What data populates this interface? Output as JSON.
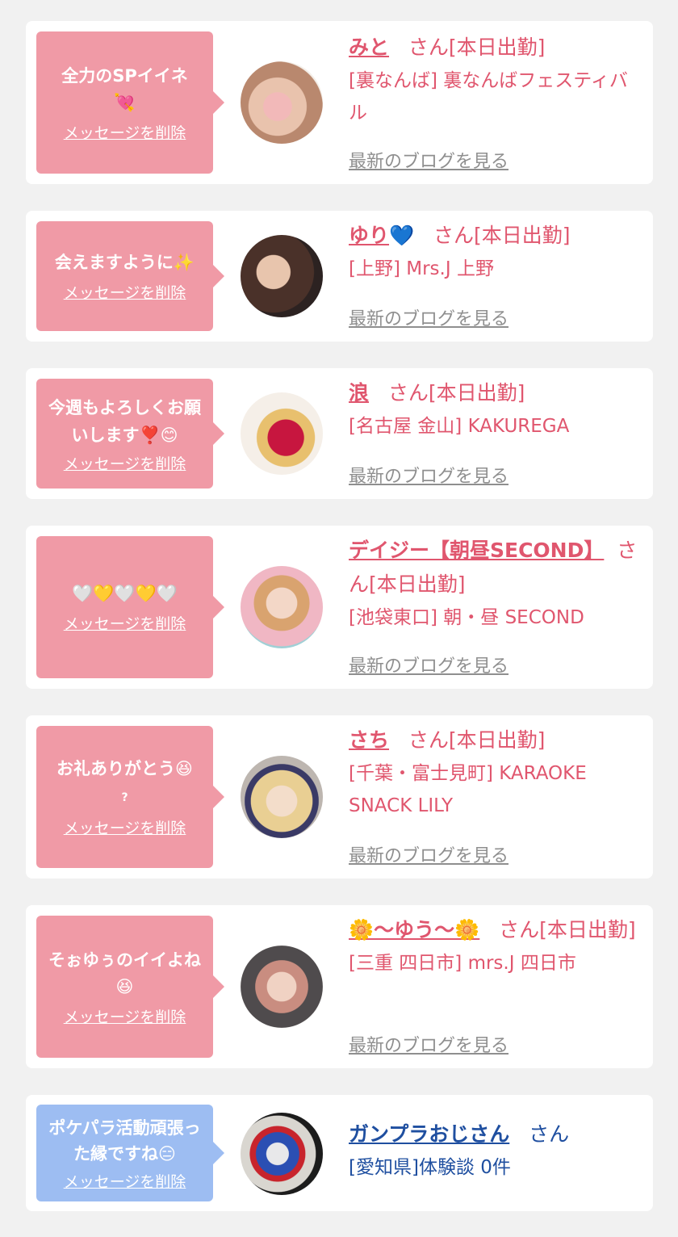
{
  "delete_label": "メッセージを削除",
  "blog_label": "最新のブログを見る",
  "cards": [
    {
      "message": "全力のSPイイネ",
      "message_emoji": "💘",
      "name": "みと",
      "suffix": "さん[本日出勤]",
      "shop": "[裏なんば] 裏なんばフェスティバル"
    },
    {
      "message": "会えますように✨",
      "name": "ゆり",
      "name_emoji": "💙",
      "suffix": "さん[本日出勤]",
      "shop": "[上野] Mrs.J 上野"
    },
    {
      "message": "今週もよろしくお願いします❣️😊",
      "name": "浪",
      "suffix": "さん[本日出勤]",
      "shop": "[名古屋 金山] KAKUREGA"
    },
    {
      "message": "🤍💛🤍💛🤍",
      "name": "デイジー【朝昼SECOND】",
      "suffix": "さん[本日出勤]",
      "shop": "[池袋東口] 朝・昼 SECOND"
    },
    {
      "message": "お礼ありがとう😆",
      "message_extra": "?",
      "name": "さち",
      "suffix": "さん[本日出勤]",
      "shop": "[千葉・富士見町] KARAOKE SNACK LILY"
    },
    {
      "message": "そぉゆぅのイイよね😆",
      "name": "🌼〜ゆう〜🌼",
      "suffix": "さん[本日出勤]",
      "shop": "[三重 四日市] mrs.J 四日市"
    },
    {
      "message": "ポケパラ活動頑張った縁ですね😑",
      "name": "ガンプラおじさん",
      "suffix": "さん",
      "shop": "[愛知県]体験談 0件"
    }
  ],
  "colors": {
    "pink_bubble": "#f09aa6",
    "blue_bubble": "#9dbdf2",
    "cast_text": "#e0566e",
    "user_text": "#1f4fa0",
    "blog_link": "#8f8f8f",
    "background": "#f1f1f1"
  }
}
